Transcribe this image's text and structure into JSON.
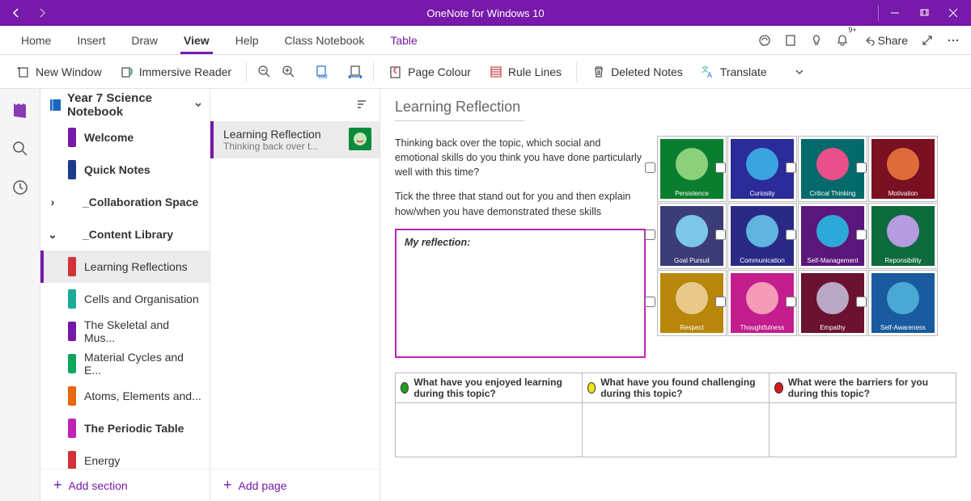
{
  "titlebar": {
    "app_title": "OneNote for Windows 10"
  },
  "tabs": {
    "items": [
      "Home",
      "Insert",
      "Draw",
      "View",
      "Help",
      "Class Notebook",
      "Table"
    ],
    "active": 3,
    "purple": [
      6
    ],
    "share_label": "Share",
    "notif_badge": "9+"
  },
  "ribbon": {
    "new_window": "New Window",
    "immersive": "Immersive Reader",
    "page_colour": "Page Colour",
    "rule_lines": "Rule Lines",
    "deleted": "Deleted Notes",
    "translate": "Translate"
  },
  "notebook": {
    "name": "Year 7 Science Notebook"
  },
  "sections": [
    {
      "label": "Welcome",
      "color": "#7719aa",
      "bold": true
    },
    {
      "label": "Quick Notes",
      "color": "#1b3a8a",
      "bold": true
    },
    {
      "label": "_Collaboration Space",
      "chev": "›",
      "bold": true
    },
    {
      "label": "_Content Library",
      "chev": "⌄",
      "bold": true
    },
    {
      "label": "Learning Reflections",
      "color": "#d13438",
      "selected": true
    },
    {
      "label": "Cells and Organisation",
      "color": "#1aab9b"
    },
    {
      "label": "The Skeletal and Mus...",
      "color": "#7719aa"
    },
    {
      "label": "Material Cycles and E...",
      "color": "#0fa85a"
    },
    {
      "label": "Atoms, Elements and...",
      "color": "#e8680c"
    },
    {
      "label": "The Periodic Table",
      "color": "#c221b7",
      "bold": true
    },
    {
      "label": "Energy",
      "color": "#d13438"
    }
  ],
  "add_section": "Add section",
  "add_page": "Add page",
  "pages": [
    {
      "title": "Learning Reflection",
      "subtitle": "Thinking back over t...",
      "selected": true
    }
  ],
  "page": {
    "title": "Learning Reflection",
    "para1": "Thinking back over the topic, which social and emotional skills do you think you have done particularly well with this time?",
    "para2": "Tick the three that stand out for you and then explain how/when you have demonstrated these skills",
    "reflection_label": "My reflection:",
    "skills": [
      {
        "name": "Persistence",
        "bg": "#0a7d2e",
        "circ": "#8dd07a"
      },
      {
        "name": "Curiosity",
        "bg": "#2b2b99",
        "circ": "#3aa3e0"
      },
      {
        "name": "Critical Thinking",
        "bg": "#026a6a",
        "circ": "#e94f8a"
      },
      {
        "name": "Motivation",
        "bg": "#7a1021",
        "circ": "#e06b3a"
      },
      {
        "name": "Goal Pursuit",
        "bg": "#3c3c78",
        "circ": "#7cc6e8"
      },
      {
        "name": "Communication",
        "bg": "#2a2a86",
        "circ": "#5fb5e0"
      },
      {
        "name": "Self-Management",
        "bg": "#5a167a",
        "circ": "#2ea7d9"
      },
      {
        "name": "Reponsibility",
        "bg": "#0d6b3e",
        "circ": "#b59be0"
      },
      {
        "name": "Respect",
        "bg": "#b8860b",
        "circ": "#e8c98a"
      },
      {
        "name": "Thoughtfulness",
        "bg": "#c41d8e",
        "circ": "#f59bb8"
      },
      {
        "name": "Empathy",
        "bg": "#6b1230",
        "circ": "#b8a8c4"
      },
      {
        "name": "Self-Awareness",
        "bg": "#1a5a9e",
        "circ": "#4aa8d4"
      }
    ],
    "cols": [
      {
        "dot": "#1ea01e",
        "q": "What have you enjoyed learning during this topic?"
      },
      {
        "dot": "#f2e21a",
        "q": "What have you found challenging during this topic?"
      },
      {
        "dot": "#d91a1a",
        "q": "What were the barriers for you during this topic?"
      }
    ]
  }
}
